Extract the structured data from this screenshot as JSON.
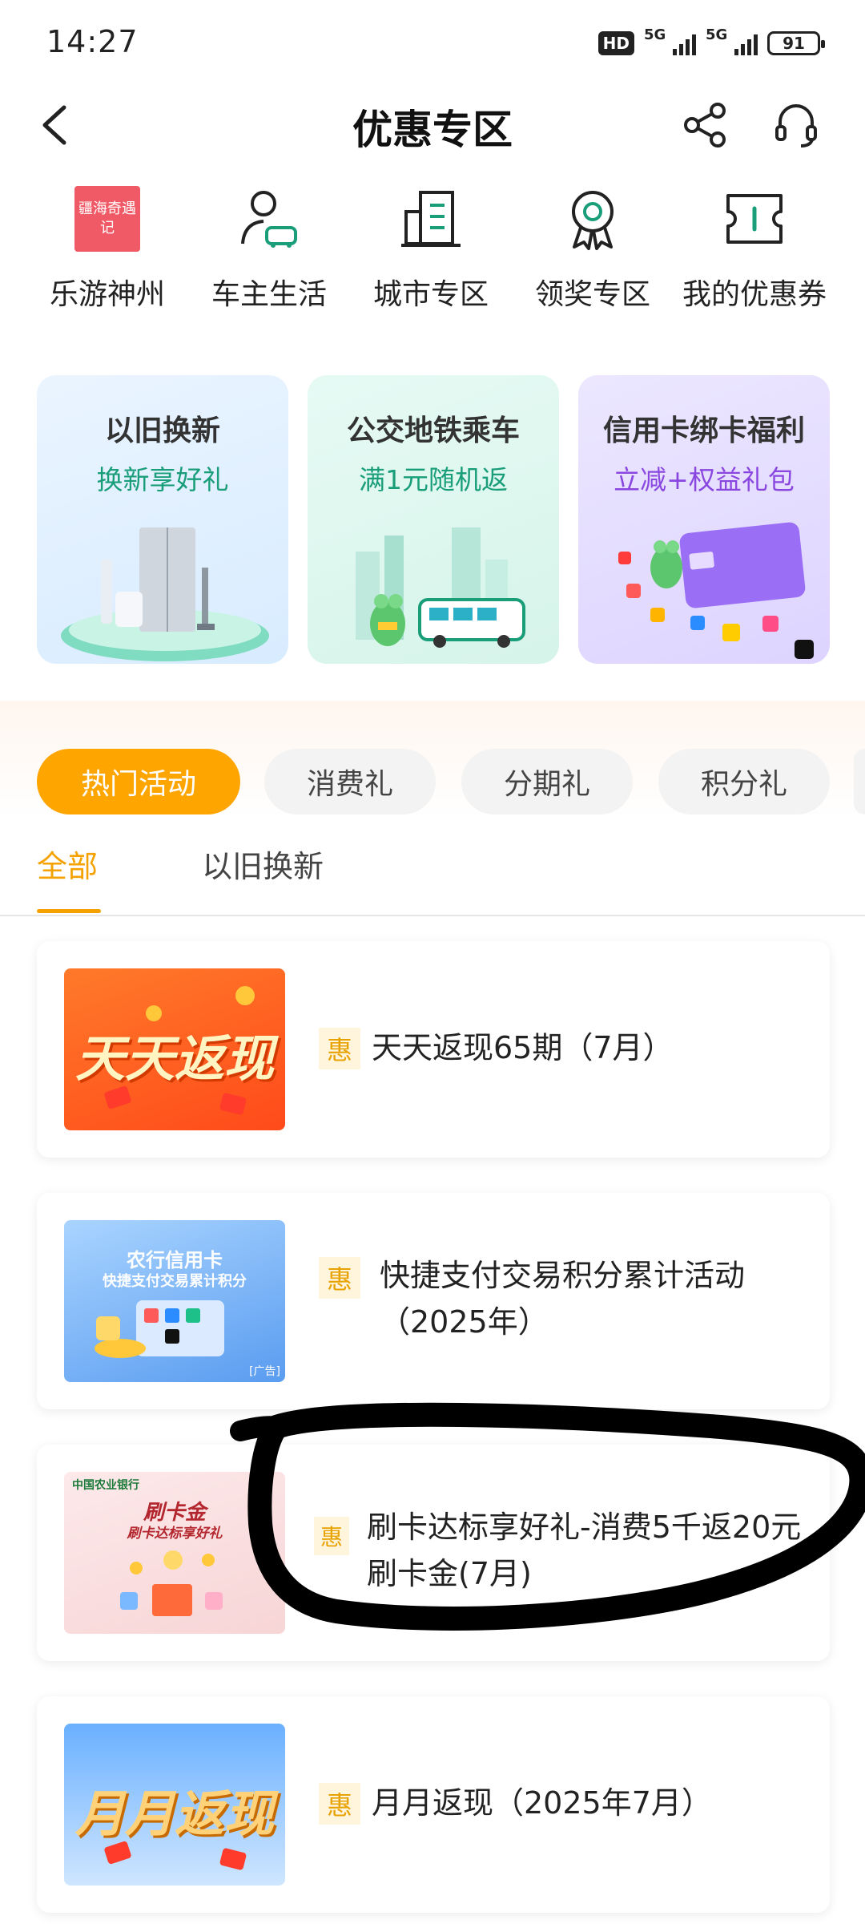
{
  "status_bar": {
    "time": "14:27",
    "hd": "HD",
    "net1": "5G",
    "net2": "5G",
    "battery": "91"
  },
  "header": {
    "title": "优惠专区",
    "back_icon": "chevron-left-icon",
    "share_icon": "share-icon",
    "service_icon": "headset-icon"
  },
  "quick_nav": [
    {
      "label": "乐游神州",
      "icon": "travel-logo-icon",
      "logo_text": "疆海奇遇记"
    },
    {
      "label": "车主生活",
      "icon": "car-owner-icon"
    },
    {
      "label": "城市专区",
      "icon": "city-building-icon"
    },
    {
      "label": "领奖专区",
      "icon": "award-medal-icon"
    },
    {
      "label": "我的优惠券",
      "icon": "coupon-icon"
    }
  ],
  "banners": [
    {
      "title": "以旧换新",
      "subtitle": "换新享好礼",
      "subtitle_color": "#1a9e7a"
    },
    {
      "title": "公交地铁乘车",
      "subtitle": "满1元随机返",
      "subtitle_color": "#1a9e7a"
    },
    {
      "title": "信用卡绑卡福利",
      "subtitle": "立减+权益礼包",
      "subtitle_color": "#8a47e0"
    }
  ],
  "category_chips": [
    "热门活动",
    "消费礼",
    "分期礼",
    "积分礼"
  ],
  "active_chip": "热门活动",
  "sub_tabs": [
    "全部",
    "以旧换新"
  ],
  "active_sub_tab": "全部",
  "badge_label": "惠",
  "activities": [
    {
      "title": "天天返现65期（7月）",
      "thumb_text": "天天返现"
    },
    {
      "title": "快捷支付交易积分累计活动（2025年）",
      "thumb_line1": "农行信用卡",
      "thumb_line2": "快捷支付交易累计积分",
      "thumb_tag": "[广告]"
    },
    {
      "title": "刷卡达标享好礼-消费5千返20元刷卡金(7月)",
      "thumb_bank": "中国农业银行",
      "thumb_line1": "刷卡金",
      "thumb_line2": "刷卡达标享好礼"
    },
    {
      "title": "月月返现（2025年7月）",
      "thumb_text": "月月返现"
    }
  ],
  "colors": {
    "accent": "#ffa500",
    "accent_text": "#f5a200",
    "badge_bg": "#fff4dc"
  }
}
